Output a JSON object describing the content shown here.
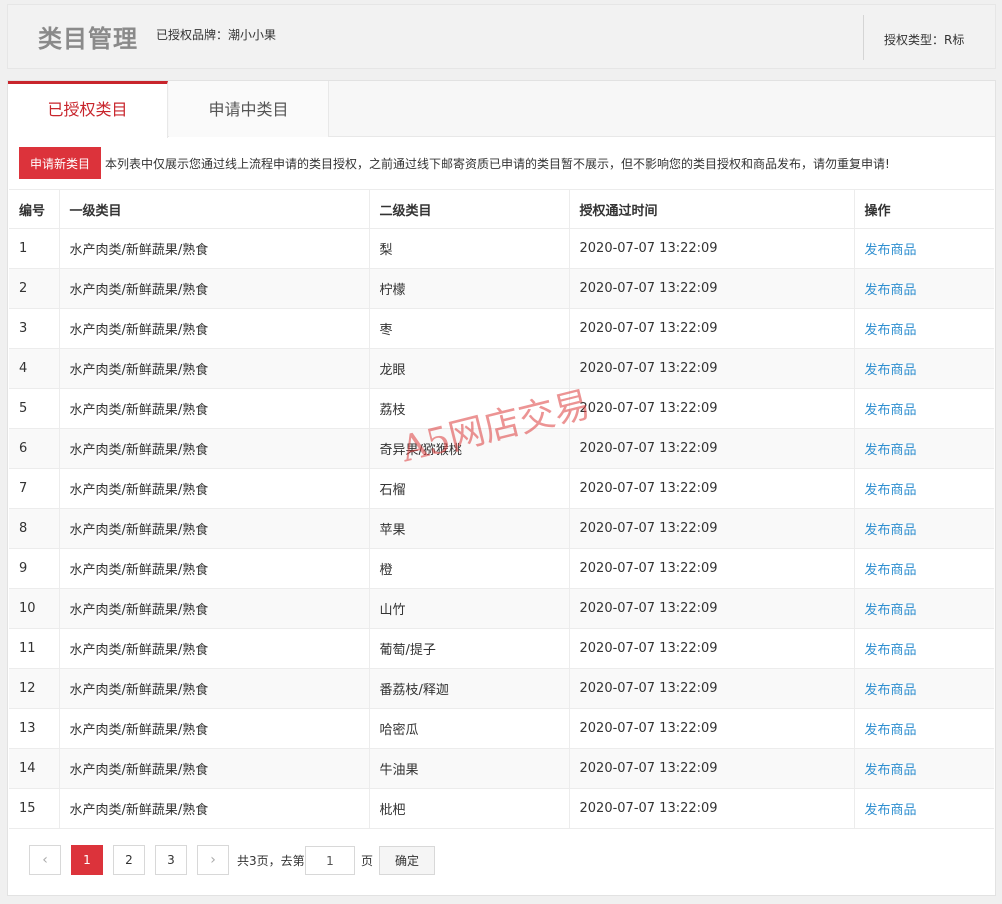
{
  "header": {
    "title": "类目管理",
    "brand": "已授权品牌：潮小小果",
    "auth_type": "授权类型：R标"
  },
  "tabs": [
    {
      "label": "已授权类目",
      "active": true
    },
    {
      "label": "申请中类目",
      "active": false
    }
  ],
  "notice": {
    "apply_button": "申请新类目",
    "text": "本列表中仅展示您通过线上流程申请的类目授权，之前通过线下邮寄资质已申请的类目暂不展示，但不影响您的类目授权和商品发布，请勿重复申请!"
  },
  "table": {
    "headers": [
      "编号",
      "一级类目",
      "二级类目",
      "授权通过时间",
      "操作"
    ],
    "rows": [
      {
        "id": "1",
        "level1": "水产肉类/新鲜蔬果/熟食",
        "level2": "梨",
        "time": "2020-07-07 13:22:09",
        "action": "发布商品"
      },
      {
        "id": "2",
        "level1": "水产肉类/新鲜蔬果/熟食",
        "level2": "柠檬",
        "time": "2020-07-07 13:22:09",
        "action": "发布商品"
      },
      {
        "id": "3",
        "level1": "水产肉类/新鲜蔬果/熟食",
        "level2": "枣",
        "time": "2020-07-07 13:22:09",
        "action": "发布商品"
      },
      {
        "id": "4",
        "level1": "水产肉类/新鲜蔬果/熟食",
        "level2": "龙眼",
        "time": "2020-07-07 13:22:09",
        "action": "发布商品"
      },
      {
        "id": "5",
        "level1": "水产肉类/新鲜蔬果/熟食",
        "level2": "荔枝",
        "time": "2020-07-07 13:22:09",
        "action": "发布商品"
      },
      {
        "id": "6",
        "level1": "水产肉类/新鲜蔬果/熟食",
        "level2": "奇异果/猕猴桃",
        "time": "2020-07-07 13:22:09",
        "action": "发布商品"
      },
      {
        "id": "7",
        "level1": "水产肉类/新鲜蔬果/熟食",
        "level2": "石榴",
        "time": "2020-07-07 13:22:09",
        "action": "发布商品"
      },
      {
        "id": "8",
        "level1": "水产肉类/新鲜蔬果/熟食",
        "level2": "苹果",
        "time": "2020-07-07 13:22:09",
        "action": "发布商品"
      },
      {
        "id": "9",
        "level1": "水产肉类/新鲜蔬果/熟食",
        "level2": "橙",
        "time": "2020-07-07 13:22:09",
        "action": "发布商品"
      },
      {
        "id": "10",
        "level1": "水产肉类/新鲜蔬果/熟食",
        "level2": "山竹",
        "time": "2020-07-07 13:22:09",
        "action": "发布商品"
      },
      {
        "id": "11",
        "level1": "水产肉类/新鲜蔬果/熟食",
        "level2": "葡萄/提子",
        "time": "2020-07-07 13:22:09",
        "action": "发布商品"
      },
      {
        "id": "12",
        "level1": "水产肉类/新鲜蔬果/熟食",
        "level2": "番荔枝/释迦",
        "time": "2020-07-07 13:22:09",
        "action": "发布商品"
      },
      {
        "id": "13",
        "level1": "水产肉类/新鲜蔬果/熟食",
        "level2": "哈密瓜",
        "time": "2020-07-07 13:22:09",
        "action": "发布商品"
      },
      {
        "id": "14",
        "level1": "水产肉类/新鲜蔬果/熟食",
        "level2": "牛油果",
        "time": "2020-07-07 13:22:09",
        "action": "发布商品"
      },
      {
        "id": "15",
        "level1": "水产肉类/新鲜蔬果/熟食",
        "level2": "枇杷",
        "time": "2020-07-07 13:22:09",
        "action": "发布商品"
      }
    ]
  },
  "pager": {
    "prev_icon": "chevron-left-icon",
    "next_icon": "chevron-right-icon",
    "pages": [
      "1",
      "2",
      "3"
    ],
    "current": "1",
    "total_prefix": "共3页，去第",
    "input_value": "1",
    "suffix": "页",
    "confirm": "确定"
  },
  "watermark": "A5网店交易",
  "colors": {
    "accent": "#dc333b",
    "link": "#2f8fd0"
  }
}
